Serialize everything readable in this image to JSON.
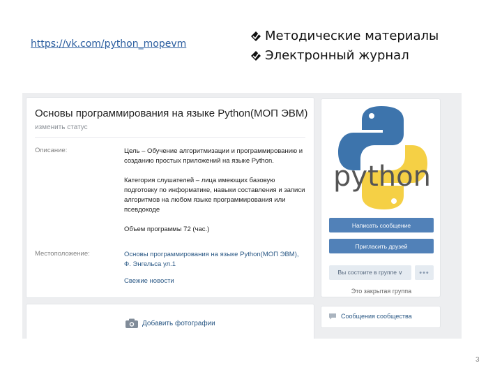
{
  "slide": {
    "link": "https://vk.com/python_mopevm",
    "bullets": [
      "Методические материалы",
      "Электронный журнал"
    ],
    "page_number": "3"
  },
  "vk": {
    "group_title": "Основы программирования на языке Python(МОП ЭВМ)",
    "status_link": "изменить статус",
    "description_label": "Описание:",
    "description_paragraphs": [
      "Цель – Обучение алгоритмизации и программированию и созданию простых приложений на языке Python.",
      "Категория слушателей – лица имеющих базовую подготовку по информатике, навыки составления и записи алгоритмов на любом языке программирования или псевдокоде",
      "Объем программы 72 (час.)"
    ],
    "location_label": "Местоположение:",
    "location_value": "Основы программирования на языке Python(МОП ЭВМ), Ф. Энгельса ул.1",
    "latest_news": "Свежие новости",
    "add_photo": "Добавить фотографии",
    "write_message": "Написать сообщение",
    "invite_friends": "Пригласить друзей",
    "member_status": "Вы состоите в группе ∨",
    "more": "•••",
    "closed_group": "Это закрытая группа",
    "community_messages": "Сообщения сообщества",
    "logo_text": "python"
  },
  "colors": {
    "vk_blue": "#5181b8",
    "link_blue": "#2a5885",
    "python_blue": "#3d74ac",
    "python_yellow": "#f5d045",
    "logo_text_gray": "#555555"
  },
  "icons": {
    "bullet": "checkmark-diamond-bullet",
    "camera": "camera-icon",
    "messages": "message-bubble-icon"
  }
}
